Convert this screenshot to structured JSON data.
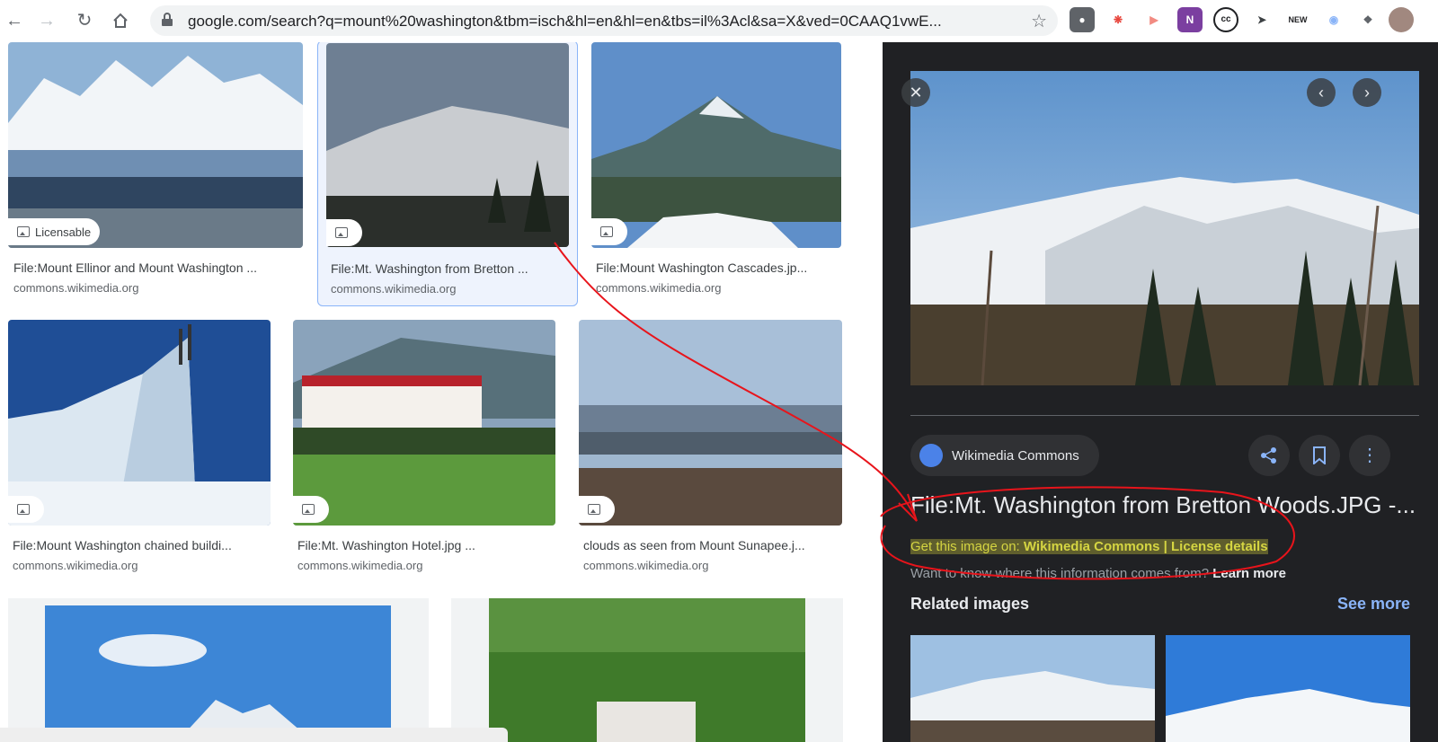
{
  "browser": {
    "url": "google.com/search?q=mount%20washington&tbm=isch&hl=en&hl=en&tbs=il%3Acl&sa=X&ved=0CAAQ1vwE...",
    "back_icon": "arrow-left-icon",
    "forward_icon": "arrow-right-icon",
    "reload_icon": "reload-icon",
    "home_icon": "home-icon"
  },
  "results": [
    {
      "title": "File:Mount Ellinor and Mount Washington ...",
      "source": "commons.wikimedia.org",
      "badge": "Licensable"
    },
    {
      "title": "File:Mt. Washington from Bretton ...",
      "source": "commons.wikimedia.org",
      "badge": ""
    },
    {
      "title": "File:Mount Washington Cascades.jp...",
      "source": "commons.wikimedia.org",
      "badge": ""
    },
    {
      "title": "File:Mount Washington chained buildi...",
      "source": "commons.wikimedia.org",
      "badge": ""
    },
    {
      "title": "File:Mt. Washington Hotel.jpg ...",
      "source": "commons.wikimedia.org",
      "badge": ""
    },
    {
      "title": "clouds as seen from Mount Sunapee.j...",
      "source": "commons.wikimedia.org",
      "badge": ""
    }
  ],
  "panel": {
    "source_name": "Wikimedia Commons",
    "title": "File:Mt. Washington from Bretton Woods.JPG -...",
    "get_prefix": "Get this image on: ",
    "get_source": "Wikimedia Commons",
    "separator": " | ",
    "license": "License details",
    "where_text": "Want to know where this information comes from? ",
    "learn_more": "Learn more",
    "related": "Related images",
    "see_more": "See more"
  },
  "colors": {
    "panel_bg": "#202124",
    "link_blue": "#8ab4f8",
    "annotation_red": "#e8141b",
    "highlight": "#d5d542"
  }
}
